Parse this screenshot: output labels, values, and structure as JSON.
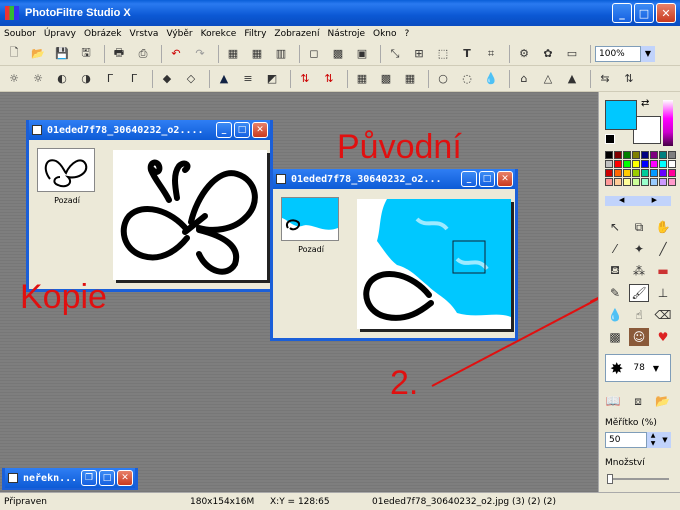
{
  "app": {
    "title": "PhotoFiltre Studio X"
  },
  "menu": [
    "Soubor",
    "Úpravy",
    "Obrázek",
    "Vrstva",
    "Výběr",
    "Korekce",
    "Filtry",
    "Zobrazení",
    "Nástroje",
    "Okno",
    "?"
  ],
  "toolbar": {
    "zoom_value": "100%"
  },
  "windows": {
    "copy": {
      "title": "01eded7f78_30640232_o2....",
      "layer_label": "Pozadí"
    },
    "original": {
      "title": "01eded7f78_30640232_o2...",
      "layer_label": "Pozadí"
    },
    "minimized": {
      "title": "neřekn..."
    }
  },
  "annotations": {
    "original_label": "Původní",
    "copy_label": "Kopie",
    "step_label": "2."
  },
  "panel": {
    "brush_size": "78",
    "scale_label": "Měřítko (%)",
    "scale_value": "50",
    "quantity_label": "Množství"
  },
  "colors": {
    "foreground": "#00c8ff",
    "background": "#ffffff",
    "accent": "#1b5fd8",
    "annotation": "#e01010"
  },
  "status": {
    "state": "Připraven",
    "dimensions": "180x154x16M",
    "coords": "X:Y = 128:65",
    "file": "01eded7f78_30640232_o2.jpg (3) (2) (2)"
  }
}
